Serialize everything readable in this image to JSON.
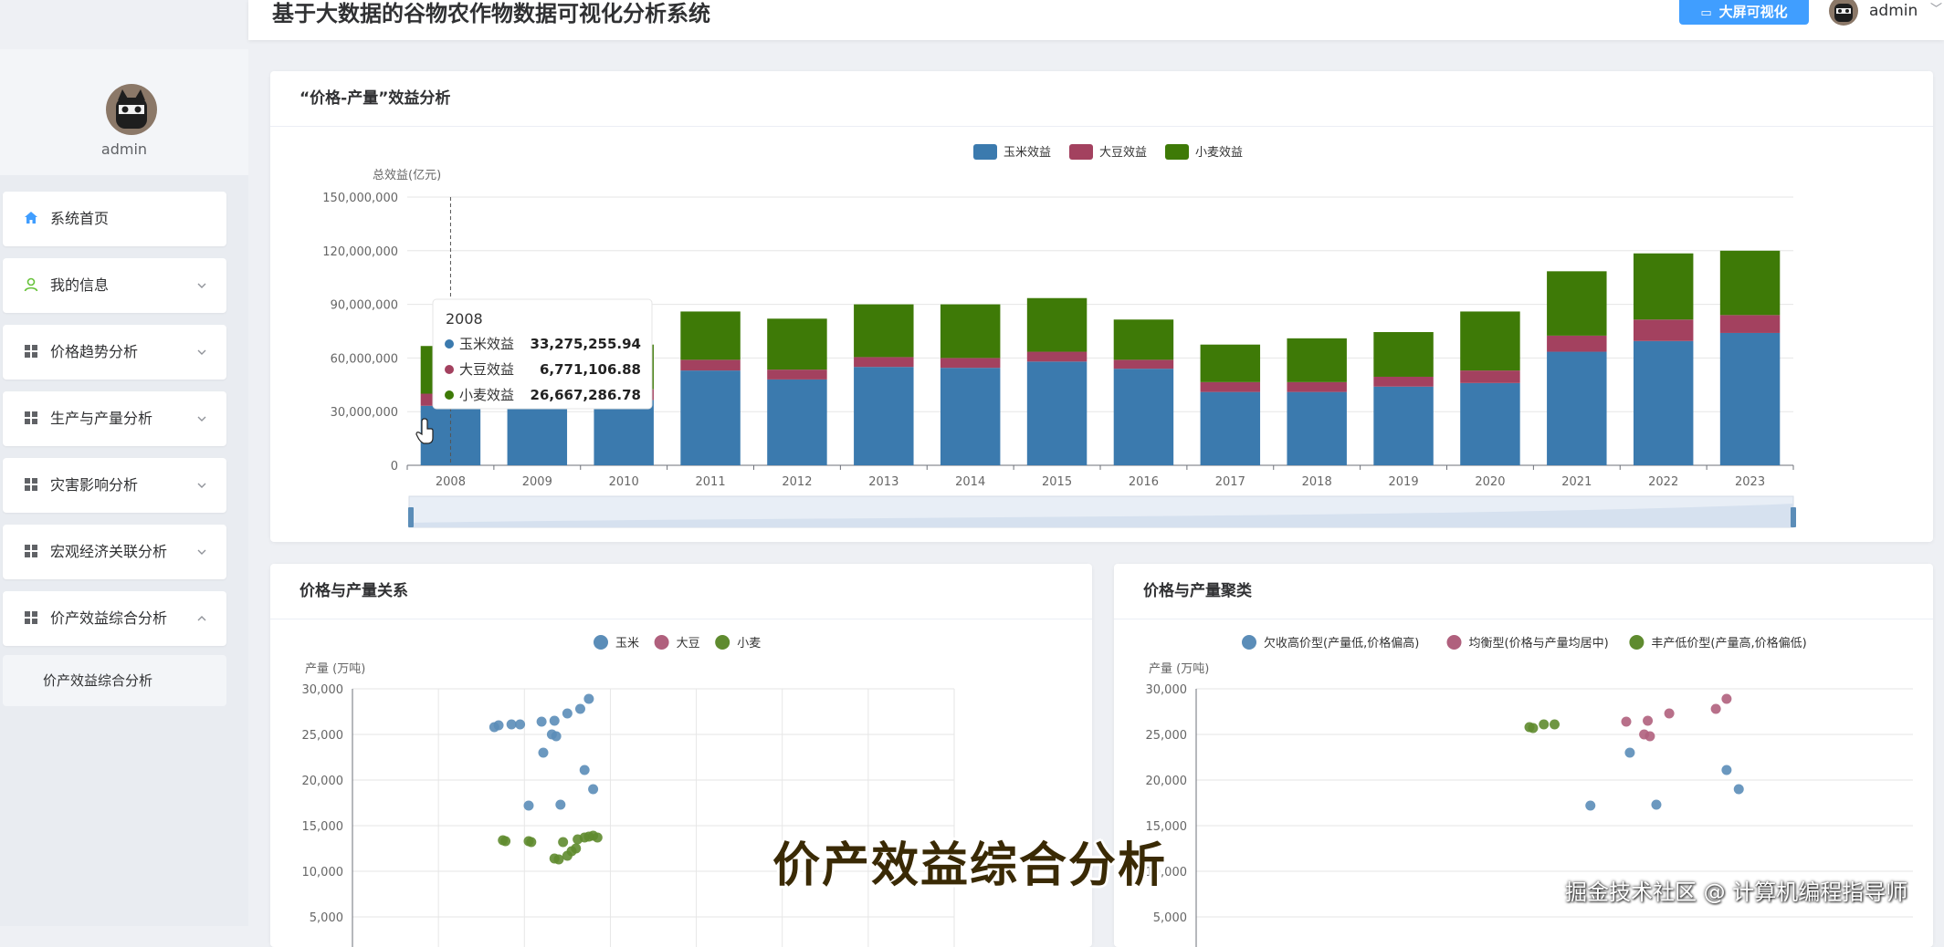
{
  "header": {
    "title": "基于大数据的谷物农作物数据可视化分析系统",
    "big_screen_label": "大屏可视化",
    "user": "admin"
  },
  "sidebar": {
    "username": "admin",
    "items": [
      {
        "label": "系统首页",
        "icon": "home-icon",
        "expandable": false
      },
      {
        "label": "我的信息",
        "icon": "user-icon",
        "expandable": true
      },
      {
        "label": "价格趋势分析",
        "icon": "grid-icon",
        "expandable": true
      },
      {
        "label": "生产与产量分析",
        "icon": "grid-icon",
        "expandable": true
      },
      {
        "label": "灾害影响分析",
        "icon": "grid-icon",
        "expandable": true
      },
      {
        "label": "宏观经济关联分析",
        "icon": "grid-icon",
        "expandable": true
      },
      {
        "label": "价产效益综合分析",
        "icon": "grid-icon",
        "expandable": true,
        "expanded": true
      }
    ],
    "subitem": "价产效益综合分析"
  },
  "cards": {
    "benefit_title": "“价格-产量”效益分析",
    "relation_title": "价格与产量关系",
    "cluster_title": "价格与产量聚类"
  },
  "chart_data": [
    {
      "type": "bar",
      "stacked": true,
      "title": "“价格-产量”效益分析",
      "ylabel": "总效益(亿元)",
      "ylim": [
        0,
        150000000
      ],
      "yticks": [
        0,
        30000000,
        60000000,
        90000000,
        120000000,
        150000000
      ],
      "ytick_labels": [
        "0",
        "30,000,000",
        "60,000,000",
        "90,000,000",
        "120,000,000",
        "150,000,000"
      ],
      "categories": [
        "2008",
        "2009",
        "2010",
        "2011",
        "2012",
        "2013",
        "2014",
        "2015",
        "2016",
        "2017",
        "2018",
        "2019",
        "2020",
        "2021",
        "2022",
        "2023"
      ],
      "legend_position": "top-center",
      "series": [
        {
          "name": "玉米效益",
          "color": "#3b7aae",
          "values": [
            33275256,
            33500000,
            36500000,
            53000000,
            48000000,
            55000000,
            54500000,
            58000000,
            54000000,
            41000000,
            41000000,
            44000000,
            46000000,
            63500000,
            69500000,
            74000000
          ]
        },
        {
          "name": "大豆效益",
          "color": "#a3415f",
          "values": [
            6771107,
            6000000,
            6000000,
            6000000,
            5500000,
            5500000,
            5500000,
            5500000,
            5000000,
            5500000,
            5500000,
            5500000,
            7000000,
            9000000,
            12000000,
            10000000
          ]
        },
        {
          "name": "小麦效益",
          "color": "#3e7a07",
          "values": [
            26667287,
            25000000,
            25000000,
            27000000,
            28500000,
            29500000,
            30000000,
            30000000,
            22500000,
            21000000,
            24500000,
            25000000,
            33000000,
            36000000,
            37000000,
            36000000
          ]
        }
      ],
      "tooltip": {
        "title": "2008",
        "rows": [
          {
            "name": "玉米效益",
            "value": "33,275,255.94",
            "color": "#3b7aae"
          },
          {
            "name": "大豆效益",
            "value": "6,771,106.88",
            "color": "#a3415f"
          },
          {
            "name": "小麦效益",
            "value": "26,667,286.78",
            "color": "#3e7a07"
          }
        ]
      }
    },
    {
      "type": "scatter",
      "title": "价格与产量关系",
      "ylabel": "产量 (万吨)",
      "ylim": [
        0,
        30000
      ],
      "yticks": [
        5000,
        10000,
        15000,
        20000,
        25000,
        30000
      ],
      "ytick_labels": [
        "5,000",
        "10,000",
        "15,000",
        "20,000",
        "25,000",
        "30,000"
      ],
      "xlim": [
        0,
        7
      ],
      "legend_position": "top-center",
      "series": [
        {
          "name": "玉米",
          "color": "#5b8db8",
          "points": [
            [
              1.65,
              25800
            ],
            [
              1.7,
              26000
            ],
            [
              1.85,
              26100
            ],
            [
              1.95,
              26100
            ],
            [
              2.05,
              17200
            ],
            [
              2.2,
              26400
            ],
            [
              2.22,
              23000
            ],
            [
              2.32,
              25000
            ],
            [
              2.35,
              26500
            ],
            [
              2.37,
              24800
            ],
            [
              2.42,
              17300
            ],
            [
              2.5,
              27300
            ],
            [
              2.65,
              27800
            ],
            [
              2.7,
              21100
            ],
            [
              2.75,
              28900
            ],
            [
              2.8,
              19000
            ]
          ]
        },
        {
          "name": "大豆",
          "color": "#b0607d",
          "points": []
        },
        {
          "name": "小麦",
          "color": "#5f8b2f",
          "points": [
            [
              1.75,
              13400
            ],
            [
              1.78,
              13300
            ],
            [
              2.05,
              13300
            ],
            [
              2.08,
              13200
            ],
            [
              2.35,
              11400
            ],
            [
              2.4,
              11300
            ],
            [
              2.45,
              13200
            ],
            [
              2.5,
              11700
            ],
            [
              2.55,
              12200
            ],
            [
              2.6,
              12500
            ],
            [
              2.62,
              13500
            ],
            [
              2.7,
              13700
            ],
            [
              2.75,
              13800
            ],
            [
              2.8,
              13900
            ],
            [
              2.85,
              13700
            ]
          ]
        }
      ]
    },
    {
      "type": "scatter",
      "title": "价格与产量聚类",
      "ylabel": "产量 (万吨)",
      "ylim": [
        0,
        30000
      ],
      "yticks": [
        5000,
        10000,
        15000,
        20000,
        25000,
        30000
      ],
      "ytick_labels": [
        "5,000",
        "10,000",
        "15,000",
        "20,000",
        "25,000",
        "30,000"
      ],
      "xlim": [
        0,
        10
      ],
      "legend_position": "top-center",
      "series": [
        {
          "name": "欠收高价型(产量低,价格偏高)",
          "color": "#5b8db8",
          "points": [
            [
              5.5,
              17200
            ],
            [
              6.05,
              23000
            ],
            [
              6.42,
              17300
            ],
            [
              7.4,
              21100
            ],
            [
              7.57,
              19000
            ]
          ]
        },
        {
          "name": "均衡型(价格与产量均居中)",
          "color": "#b0607d",
          "points": [
            [
              6.0,
              26400
            ],
            [
              6.25,
              25000
            ],
            [
              6.3,
              26500
            ],
            [
              6.33,
              24800
            ],
            [
              6.6,
              27300
            ],
            [
              7.25,
              27800
            ],
            [
              7.4,
              28900
            ]
          ]
        },
        {
          "name": "丰产低价型(产量高,价格偏低)",
          "color": "#5f8b2f",
          "points": [
            [
              4.65,
              25800
            ],
            [
              4.7,
              25700
            ],
            [
              4.85,
              26100
            ],
            [
              5.0,
              26100
            ]
          ]
        }
      ]
    }
  ],
  "overlay": {
    "subtitle": "价产效益综合分析",
    "watermark": "掘金技术社区 @ 计算机编程指导师"
  }
}
